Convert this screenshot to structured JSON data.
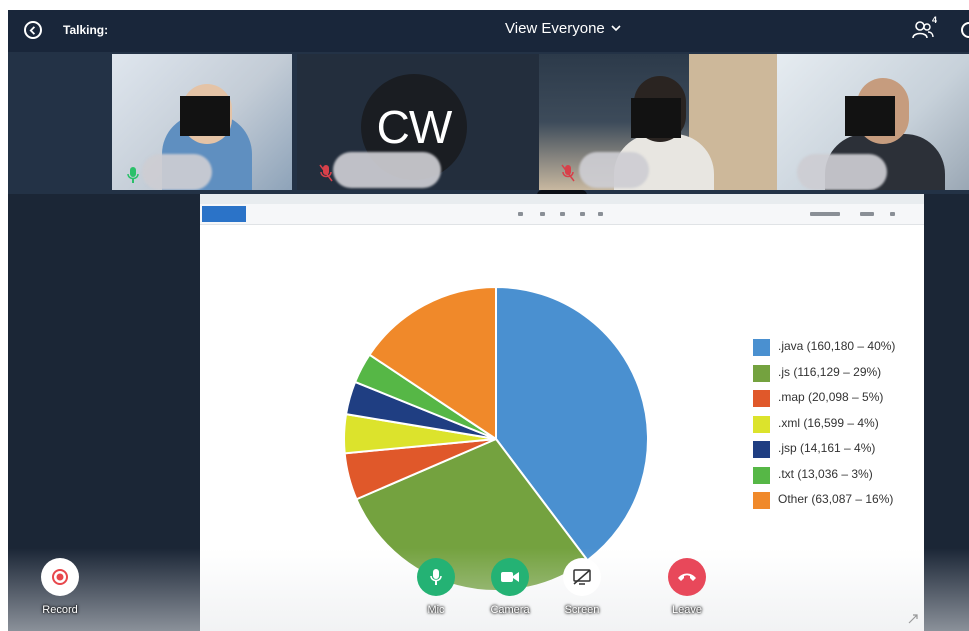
{
  "topbar": {
    "talking_label": "Talking:",
    "view_label": "View Everyone",
    "participants_count": "4",
    "icons": [
      "info-circle-icon",
      "chevron-down-icon",
      "people-icon"
    ]
  },
  "participants": [
    {
      "tile": "participant-1",
      "mic": "on",
      "video": "on"
    },
    {
      "tile": "participant-2",
      "initials": "CW",
      "mic": "muted",
      "video": "off"
    },
    {
      "tile": "participant-3",
      "mic": "muted",
      "video": "on"
    },
    {
      "tile": "participant-4",
      "mic": "on",
      "video": "on"
    }
  ],
  "chart_data": {
    "type": "pie",
    "slices": [
      {
        "label": ".java (160,180 – 40%)",
        "name": ".java",
        "value": 160180,
        "percent": 40,
        "color": "#4a90d0"
      },
      {
        "label": ".js (116,129 – 29%)",
        "name": ".js",
        "value": 116129,
        "percent": 29,
        "color": "#74a23f"
      },
      {
        "label": ".map (20,098 – 5%)",
        "name": ".map",
        "value": 20098,
        "percent": 5,
        "color": "#e0582a"
      },
      {
        "label": ".xml (16,599 – 4%)",
        "name": ".xml",
        "value": 16599,
        "percent": 4,
        "color": "#dce32c"
      },
      {
        "label": ".jsp (14,161 – 4%)",
        "name": ".jsp",
        "value": 14161,
        "percent": 4,
        "color": "#1f3e82"
      },
      {
        "label": ".txt (13,036 – 3%)",
        "name": ".txt",
        "value": 13036,
        "percent": 3,
        "color": "#56b746"
      },
      {
        "label": "Other (63,087 – 16%)",
        "name": "Other",
        "value": 63087,
        "percent": 16,
        "color": "#f0892a"
      }
    ],
    "legend_position": "right"
  },
  "controls": {
    "record": {
      "label": "Record",
      "color": "#e8474c",
      "icon": "record-icon"
    },
    "mic": {
      "label": "Mic",
      "color": "#24b274",
      "icon": "mic-icon"
    },
    "camera": {
      "label": "Camera",
      "color": "#24b274",
      "icon": "camera-icon"
    },
    "screen": {
      "label": "Screen",
      "color": "#ffffff",
      "icon": "screen-share-icon"
    },
    "leave": {
      "label": "Leave",
      "color": "#e8485a",
      "icon": "hang-up-icon"
    }
  }
}
